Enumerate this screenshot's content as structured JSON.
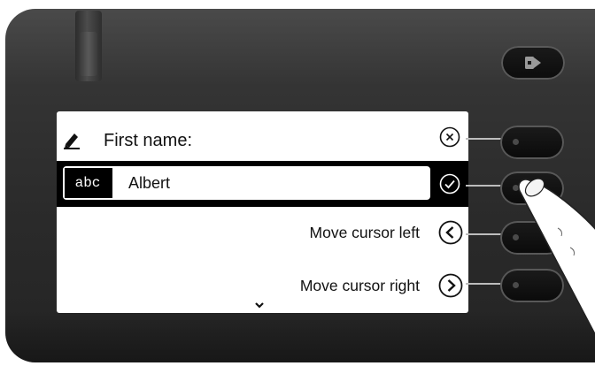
{
  "screen": {
    "title_row": {
      "label": "First name:",
      "icon": "pencil-icon",
      "action_icon": "cancel-x-icon"
    },
    "input_row": {
      "mode": "abc",
      "value": "Albert",
      "action_icon": "confirm-check-icon"
    },
    "options": [
      {
        "label": "Move cursor left",
        "icon": "chevron-left-icon"
      },
      {
        "label": "Move cursor right",
        "icon": "chevron-right-icon"
      }
    ],
    "scroll_indicator": "chevron-down-icon"
  },
  "hardware": {
    "exit_key_icon": "exit-arrow-icon",
    "side_keys": [
      "side-key-1",
      "side-key-2",
      "side-key-3",
      "side-key-4"
    ]
  },
  "colors": {
    "housing": "#2e2e2e",
    "screen_bg": "#ffffff",
    "selected_row": "#000000"
  }
}
